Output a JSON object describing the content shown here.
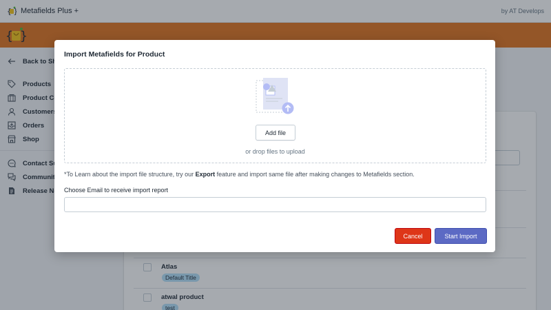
{
  "app": {
    "name": "Metafields Plus +",
    "by": "by AT Develops"
  },
  "colors": {
    "brand": "#e2741e",
    "accent": "#5c6ac4",
    "danger": "#de3618",
    "badge": "#b4e1fa"
  },
  "sidebar": {
    "items": [
      {
        "label": "Back to Sh",
        "icon": "arrow-left-icon"
      },
      {
        "label": "Products",
        "icon": "tag-icon"
      },
      {
        "label": "Product Co",
        "icon": "collection-icon"
      },
      {
        "label": "Customers",
        "icon": "person-icon"
      },
      {
        "label": "Orders",
        "icon": "inbox-icon"
      },
      {
        "label": "Shop",
        "icon": "store-icon"
      },
      {
        "label": "Contact Su",
        "icon": "chat-icon"
      },
      {
        "label": "Communit",
        "icon": "conversation-icon"
      },
      {
        "label": "Release No",
        "icon": "document-icon"
      }
    ]
  },
  "products": [
    {
      "name": "Atlas",
      "badge": "Default Title"
    },
    {
      "name": "atwal product",
      "badge": "test"
    }
  ],
  "modal": {
    "title": "Import Metafields for Product",
    "add_file_label": "Add file",
    "drop_hint": "or drop files to upload",
    "note_prefix": "*To Learn about the import file structure, try our ",
    "note_bold": "Export",
    "note_suffix": " feature and import same file after making changes to Metafields section.",
    "email_label": "Choose Email to receive import report",
    "email_value": "",
    "cancel_label": "Cancel",
    "start_label": "Start Import"
  }
}
